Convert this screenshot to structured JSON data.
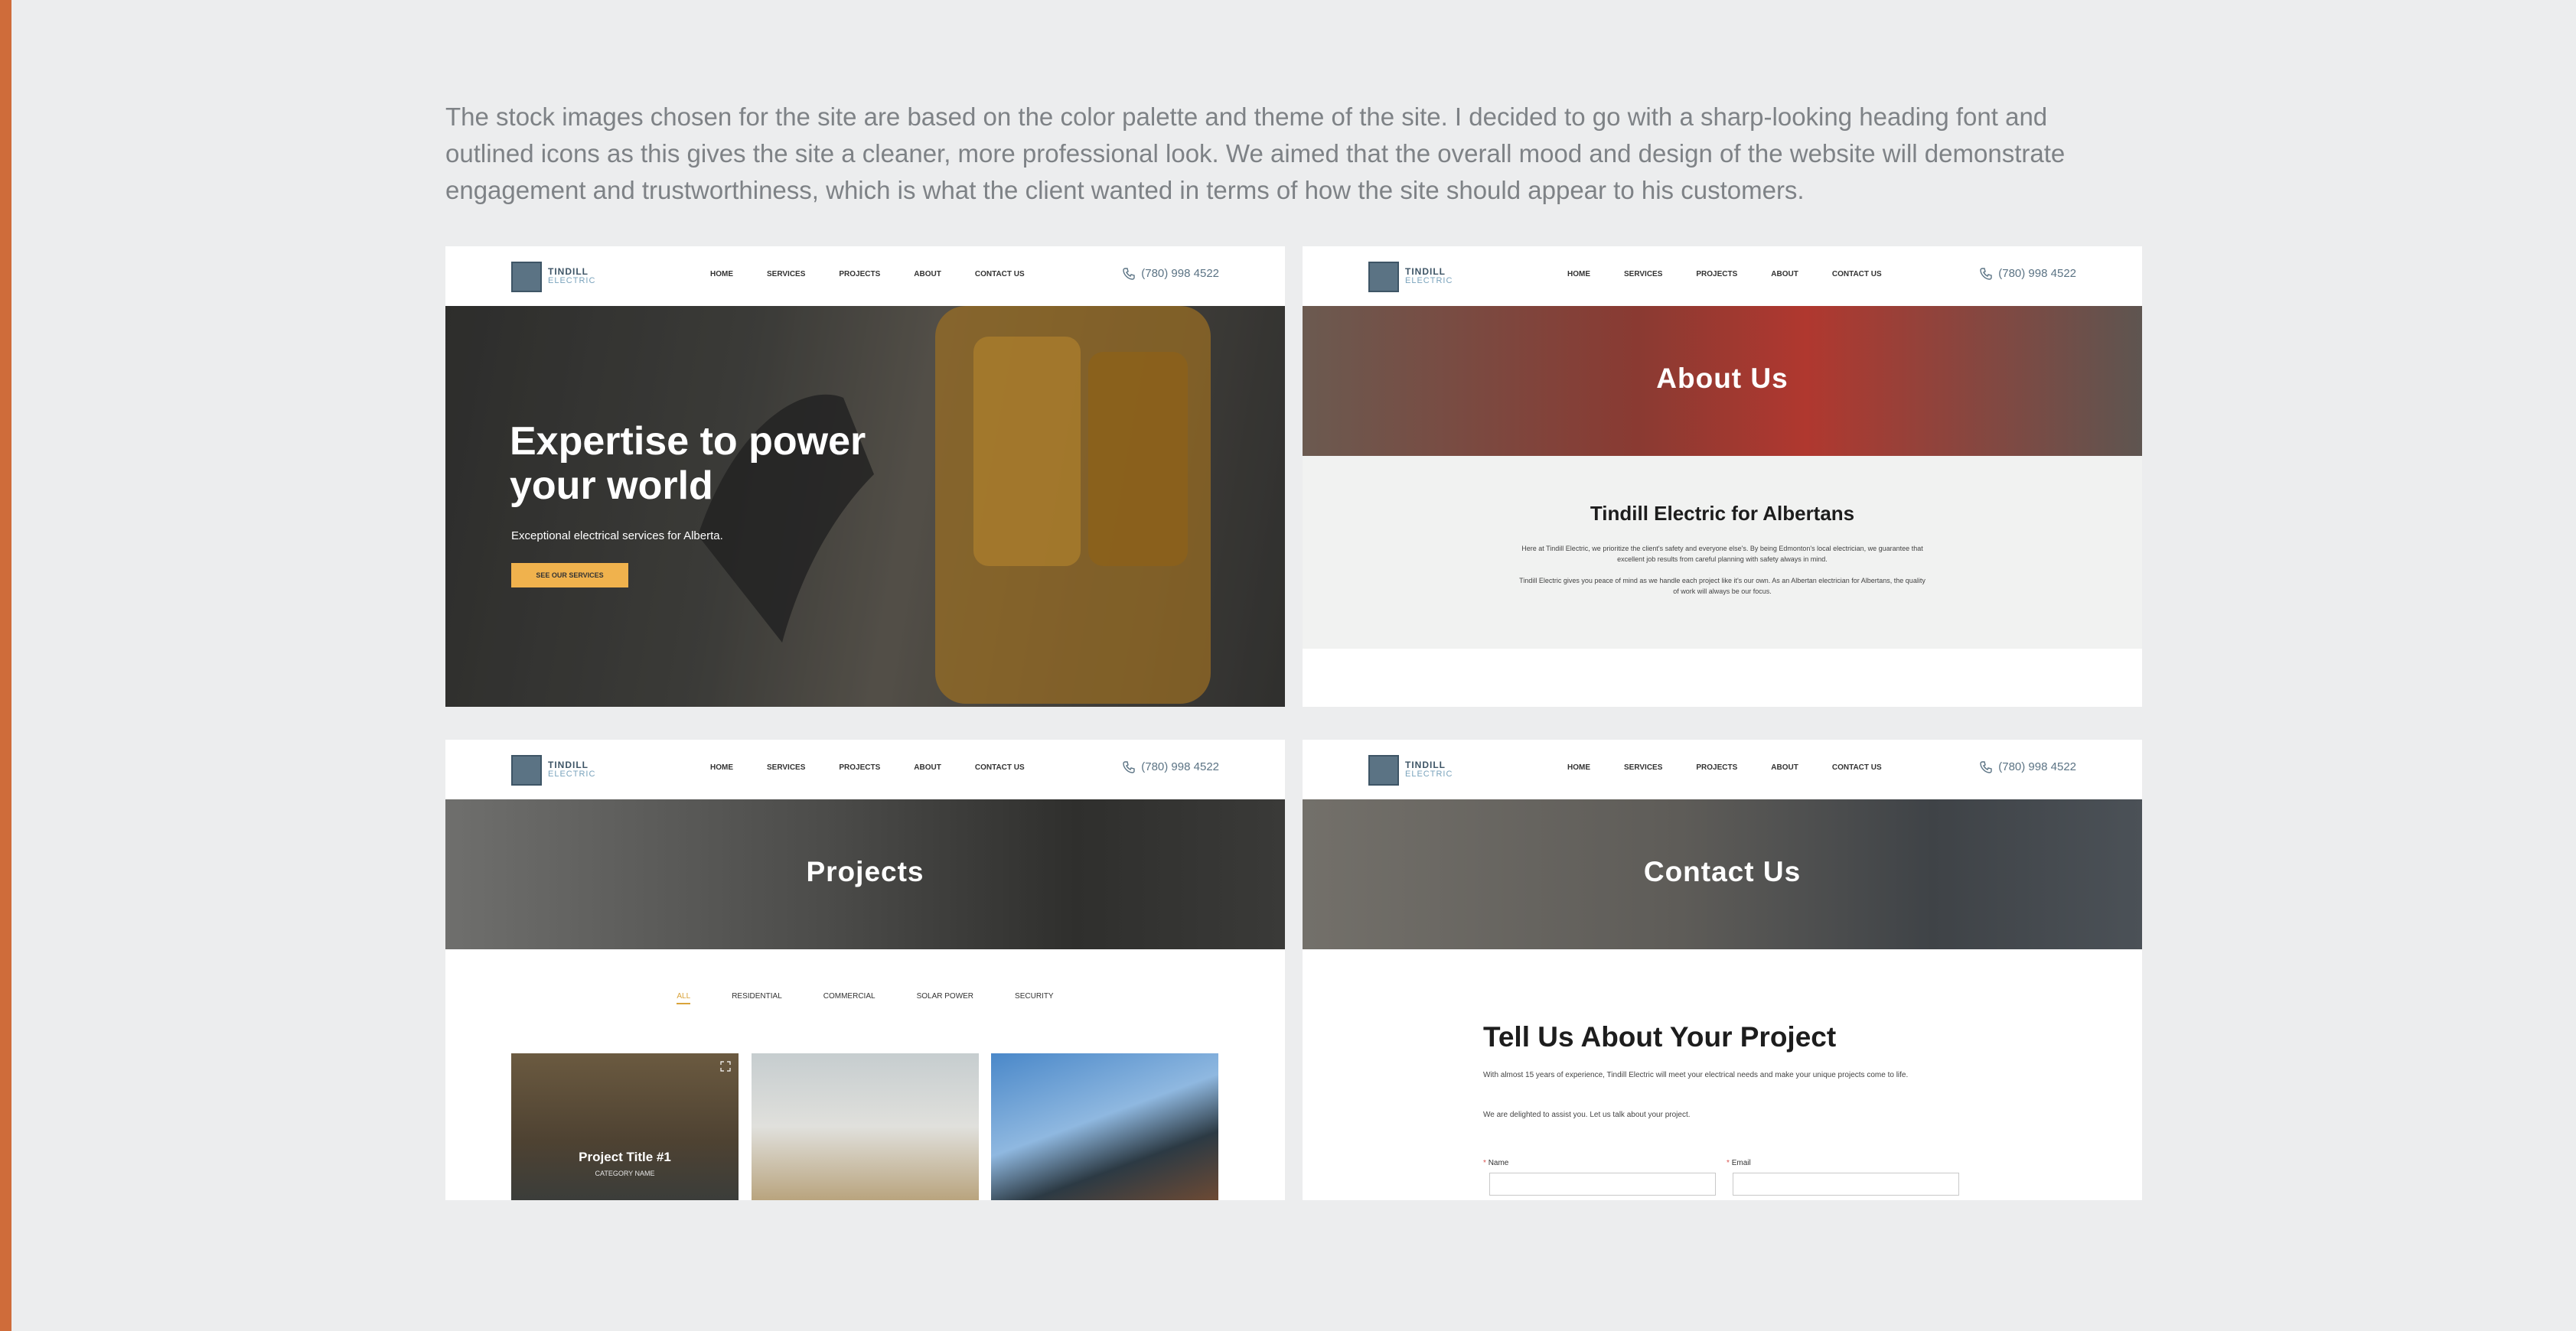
{
  "intro_text": "The stock images chosen for the site are based on the color palette and theme of the site. I decided to go with a sharp-looking heading font and outlined icons as this gives the site a cleaner, more professional look. We aimed that the overall mood and design of the website will demonstrate engagement and trustworthiness, which is what the client wanted in terms of how the site should appear to his customers.",
  "colors": {
    "accent_bar": "#cf6c3a",
    "button": "#f0b24d",
    "brand": "#5b7384"
  },
  "site": {
    "logo_line1": "TINDILL",
    "logo_line2": "ELECTRIC",
    "nav": [
      "HOME",
      "SERVICES",
      "PROJECTS",
      "ABOUT",
      "CONTACT US"
    ],
    "phone": "(780) 998 4522"
  },
  "home": {
    "hero_title": "Expertise to power your world",
    "hero_subtitle": "Exceptional electrical services for Alberta.",
    "cta_label": "SEE OUR SERVICES"
  },
  "about": {
    "banner_title": "About Us",
    "heading": "Tindill Electric for Albertans",
    "p1": "Here at Tindill Electric, we prioritize the client's safety and everyone else's. By being Edmonton's local electrician, we guarantee that excellent job results from careful planning with safety always in mind.",
    "p2": "Tindill Electric gives you peace of mind as we handle each project like it's our own. As an Albertan electrician for Albertans, the quality of work will always be our focus."
  },
  "projects": {
    "banner_title": "Projects",
    "filters": [
      "ALL",
      "RESIDENTIAL",
      "COMMERCIAL",
      "SOLAR POWER",
      "SECURITY"
    ],
    "active_filter": "ALL",
    "tile_title": "Project Title #1",
    "tile_category": "CATEGORY NAME"
  },
  "contact": {
    "banner_title": "Contact Us",
    "heading": "Tell Us About Your Project",
    "p1": "With almost 15 years of experience, Tindill Electric will meet your electrical needs and make your unique projects come to life.",
    "p2": "We are delighted to assist you. Let us talk about your project.",
    "name_label": "Name",
    "email_label": "Email",
    "required_mark": "*"
  }
}
